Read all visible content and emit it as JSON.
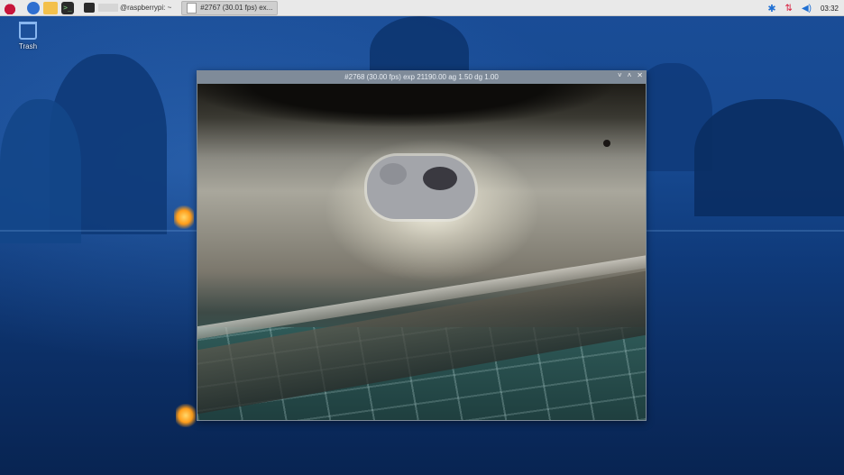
{
  "taskbar": {
    "tasks": [
      {
        "label": "@raspberrypi: ~"
      },
      {
        "label": "#2767 (30.01 fps) ex..."
      }
    ],
    "clock": "03:32"
  },
  "desktop": {
    "trash_label": "Trash"
  },
  "camera_window": {
    "title": "#2768 (30.00 fps) exp 21190.00 ag 1.50 dg 1.00",
    "controls": {
      "minimize": "˅",
      "maximize": "˄",
      "close": "✕"
    }
  },
  "colors": {
    "taskbar_bg": "#e9e9e9",
    "window_title_bg": "#7f8b99",
    "bluetooth": "#1f6fd3",
    "network_error": "#d81b3c"
  }
}
